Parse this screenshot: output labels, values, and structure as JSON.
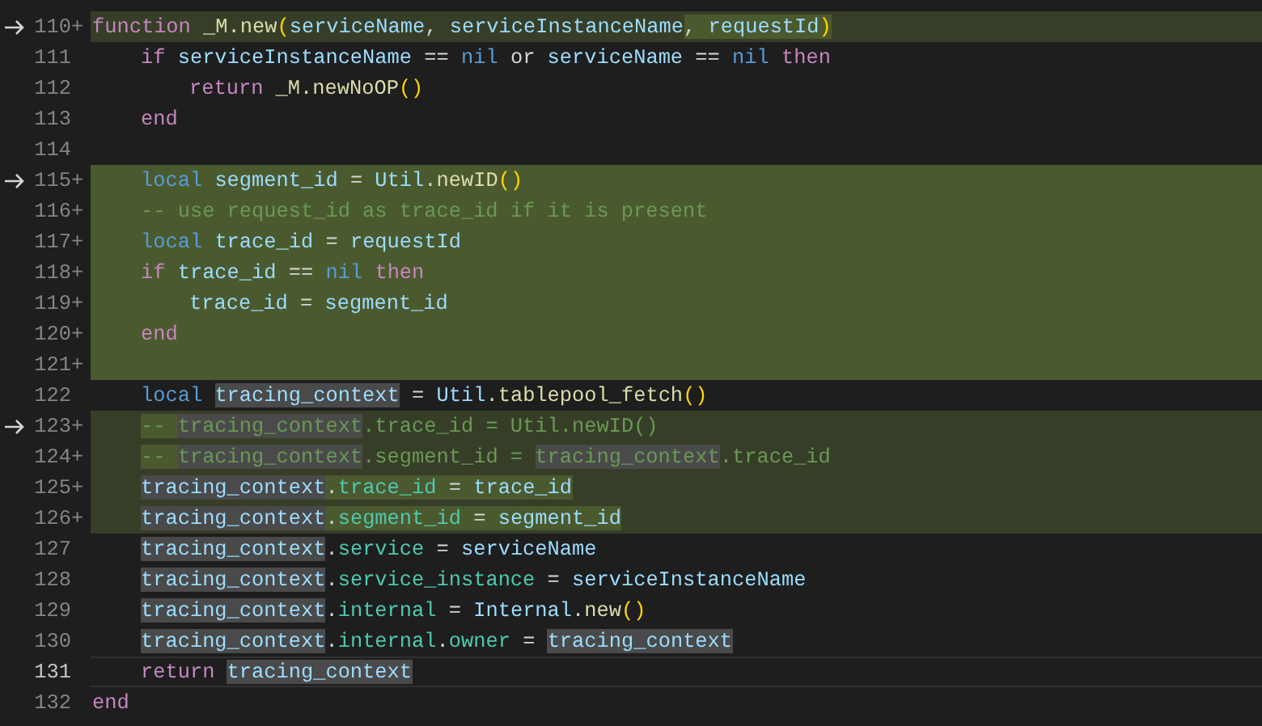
{
  "editor": {
    "lines": [
      {
        "number": "110",
        "marker": "+",
        "arrow": true,
        "current": false,
        "kind": "changed",
        "tokens": [
          {
            "t": "function ",
            "kind": "kw"
          },
          {
            "t": "_M.new",
            "kind": "fn"
          },
          {
            "t": "(",
            "kind": "br"
          },
          {
            "t": "serviceName",
            "kind": "var"
          },
          {
            "t": ", ",
            "kind": "pn"
          },
          {
            "t": "serviceInstanceName",
            "kind": "var"
          },
          {
            "t": ", ",
            "kind": "pn",
            "inserted": true
          },
          {
            "t": "requestId",
            "kind": "var",
            "inserted": true
          },
          {
            "t": ")",
            "kind": "br",
            "inserted": true
          }
        ],
        "children": [
          {
            "number": "111",
            "arrow": false,
            "current": false,
            "kind": "plain",
            "tokens": [
              {
                "t": "if ",
                "kind": "kw"
              },
              {
                "t": "serviceInstanceName",
                "kind": "var"
              },
              {
                "t": " == ",
                "kind": "pn"
              },
              {
                "t": "nil ",
                "kind": "st"
              },
              {
                "t": "or ",
                "kind": "pn"
              },
              {
                "t": "serviceName",
                "kind": "var"
              },
              {
                "t": " == ",
                "kind": "pn"
              },
              {
                "t": "nil ",
                "kind": "st"
              },
              {
                "t": "then",
                "kind": "kw"
              }
            ],
            "children": [
              {
                "number": "112",
                "arrow": false,
                "current": false,
                "kind": "plain",
                "tokens": [
                  {
                    "t": "return ",
                    "kind": "kw"
                  },
                  {
                    "t": "_M.newNoOP",
                    "kind": "fn"
                  },
                  {
                    "t": "()",
                    "kind": "br"
                  }
                ]
              }
            ]
          },
          {
            "number": "113",
            "arrow": false,
            "current": false,
            "kind": "plain",
            "tokens": [
              {
                "t": "end",
                "kind": "kw"
              }
            ]
          },
          {
            "number": "114",
            "arrow": false,
            "current": false,
            "kind": "plain"
          },
          {
            "number": "115",
            "marker": "+",
            "arrow": true,
            "current": false,
            "kind": "added",
            "tokens": [
              {
                "t": "local ",
                "kind": "st"
              },
              {
                "t": "segment_id",
                "kind": "var"
              },
              {
                "t": " = ",
                "kind": "pn"
              },
              {
                "t": "Util",
                "kind": "var"
              },
              {
                "t": ".",
                "kind": "pn"
              },
              {
                "t": "newID",
                "kind": "fn"
              },
              {
                "t": "()",
                "kind": "br"
              }
            ]
          },
          {
            "number": "116",
            "marker": "+",
            "arrow": false,
            "current": false,
            "kind": "added",
            "tokens": [
              {
                "t": "-- use request_id as trace_id if it is present",
                "kind": "cm"
              }
            ]
          },
          {
            "number": "117",
            "marker": "+",
            "arrow": false,
            "current": false,
            "kind": "added",
            "tokens": [
              {
                "t": "local ",
                "kind": "st"
              },
              {
                "t": "trace_id",
                "kind": "var"
              },
              {
                "t": " = ",
                "kind": "pn"
              },
              {
                "t": "requestId",
                "kind": "var"
              }
            ]
          },
          {
            "number": "118",
            "marker": "+",
            "arrow": false,
            "current": false,
            "kind": "added",
            "tokens": [
              {
                "t": "if ",
                "kind": "kw"
              },
              {
                "t": "trace_id",
                "kind": "var"
              },
              {
                "t": " == ",
                "kind": "pn"
              },
              {
                "t": "nil ",
                "kind": "st"
              },
              {
                "t": "then",
                "kind": "kw"
              }
            ],
            "children": [
              {
                "number": "119",
                "marker": "+",
                "arrow": false,
                "current": false,
                "kind": "added",
                "tokens": [
                  {
                    "t": "trace_id",
                    "kind": "var"
                  },
                  {
                    "t": " = ",
                    "kind": "pn"
                  },
                  {
                    "t": "segment_id",
                    "kind": "var"
                  }
                ]
              }
            ]
          },
          {
            "number": "120",
            "marker": "+",
            "arrow": false,
            "current": false,
            "kind": "added",
            "tokens": [
              {
                "t": "end",
                "kind": "kw"
              }
            ]
          },
          {
            "number": "121",
            "marker": "+",
            "arrow": false,
            "current": false,
            "kind": "added"
          },
          {
            "number": "122",
            "arrow": false,
            "current": false,
            "kind": "plain",
            "tokens": [
              {
                "t": "local ",
                "kind": "st"
              },
              {
                "t": "tracing_context",
                "kind": "var",
                "match": true
              },
              {
                "t": " = ",
                "kind": "pn"
              },
              {
                "t": "Util",
                "kind": "var"
              },
              {
                "t": ".",
                "kind": "pn"
              },
              {
                "t": "tablepool_fetch",
                "kind": "fn"
              },
              {
                "t": "()",
                "kind": "br"
              }
            ]
          },
          {
            "number": "123",
            "marker": "+",
            "arrow": true,
            "current": false,
            "kind": "changed",
            "tokens": [
              {
                "t": "-- ",
                "kind": "cm",
                "inserted": true
              },
              {
                "t": "tracing_context",
                "kind": "cm",
                "match": true
              },
              {
                "t": ".trace_id = Util.newID()",
                "kind": "cm"
              }
            ]
          },
          {
            "number": "124",
            "marker": "+",
            "arrow": false,
            "current": false,
            "kind": "changed",
            "tokens": [
              {
                "t": "-- ",
                "kind": "cm",
                "inserted": true
              },
              {
                "t": "tracing_context",
                "kind": "cm",
                "match": true
              },
              {
                "t": ".segment_id = ",
                "kind": "cm"
              },
              {
                "t": "tracing_context",
                "kind": "cm",
                "match": true
              },
              {
                "t": ".trace_id",
                "kind": "cm"
              }
            ]
          },
          {
            "number": "125",
            "marker": "+",
            "arrow": false,
            "current": false,
            "kind": "changed",
            "tokens": [
              {
                "t": "tracing_context",
                "kind": "var",
                "match": true
              },
              {
                "t": ".",
                "kind": "pn",
                "inserted": true
              },
              {
                "t": "trace_id",
                "kind": "fd",
                "inserted": true
              },
              {
                "t": " = ",
                "kind": "pn",
                "inserted": true
              },
              {
                "t": "trace_id",
                "kind": "var",
                "inserted": true
              }
            ]
          },
          {
            "number": "126",
            "marker": "+",
            "arrow": false,
            "current": false,
            "kind": "changed",
            "tokens": [
              {
                "t": "tracing_context",
                "kind": "var",
                "match": true
              },
              {
                "t": ".",
                "kind": "pn",
                "inserted": true
              },
              {
                "t": "segment_id",
                "kind": "fd",
                "inserted": true
              },
              {
                "t": " = ",
                "kind": "pn",
                "inserted": true
              },
              {
                "t": "segment_id",
                "kind": "var",
                "inserted": true
              }
            ]
          },
          {
            "number": "127",
            "arrow": false,
            "current": false,
            "kind": "plain",
            "tokens": [
              {
                "t": "tracing_context",
                "kind": "var",
                "match": true
              },
              {
                "t": ".",
                "kind": "pn"
              },
              {
                "t": "service",
                "kind": "fd"
              },
              {
                "t": " = ",
                "kind": "pn"
              },
              {
                "t": "serviceName",
                "kind": "var"
              }
            ]
          },
          {
            "number": "128",
            "arrow": false,
            "current": false,
            "kind": "plain",
            "tokens": [
              {
                "t": "tracing_context",
                "kind": "var",
                "match": true
              },
              {
                "t": ".",
                "kind": "pn"
              },
              {
                "t": "service_instance",
                "kind": "fd"
              },
              {
                "t": " = ",
                "kind": "pn"
              },
              {
                "t": "serviceInstanceName",
                "kind": "var"
              }
            ]
          },
          {
            "number": "129",
            "arrow": false,
            "current": false,
            "kind": "plain",
            "tokens": [
              {
                "t": "tracing_context",
                "kind": "var",
                "match": true
              },
              {
                "t": ".",
                "kind": "pn"
              },
              {
                "t": "internal",
                "kind": "fd"
              },
              {
                "t": " = ",
                "kind": "pn"
              },
              {
                "t": "Internal",
                "kind": "var"
              },
              {
                "t": ".",
                "kind": "pn"
              },
              {
                "t": "new",
                "kind": "fn"
              },
              {
                "t": "()",
                "kind": "br"
              }
            ]
          },
          {
            "number": "130",
            "arrow": false,
            "current": false,
            "kind": "plain",
            "tokens": [
              {
                "t": "tracing_context",
                "kind": "var",
                "match": true
              },
              {
                "t": ".",
                "kind": "pn"
              },
              {
                "t": "internal",
                "kind": "fd"
              },
              {
                "t": ".",
                "kind": "pn"
              },
              {
                "t": "owner",
                "kind": "fd"
              },
              {
                "t": " = ",
                "kind": "pn"
              },
              {
                "t": "tracing_context",
                "kind": "var",
                "match": true
              }
            ]
          },
          {
            "number": "131",
            "arrow": false,
            "current": true,
            "kind": "plain",
            "tokens": [
              {
                "t": "return ",
                "kind": "kw"
              },
              {
                "t": "tracing_context",
                "kind": "var",
                "match": true
              }
            ]
          }
        ]
      },
      {
        "number": "132",
        "arrow": false,
        "current": false,
        "kind": "plain",
        "tokens": [
          {
            "t": "end",
            "kind": "kw"
          }
        ]
      }
    ]
  }
}
